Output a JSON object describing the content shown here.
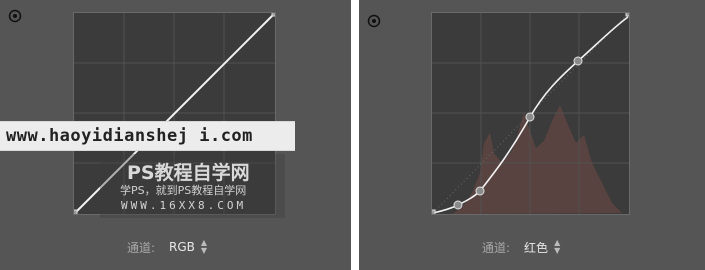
{
  "left_panel": {
    "channel_label": "通道:",
    "channel_value": "RGB"
  },
  "right_panel": {
    "channel_label": "通道:",
    "channel_value": "红色"
  },
  "watermark": {
    "url": "www.haoyidianshej i.com",
    "title": "PS教程自学网",
    "subtitle": "学PS，就到PS教程自学网",
    "site": "WWW.16XX8.COM"
  },
  "colors": {
    "panel_bg": "#555555",
    "curve_bg": "#3b3b3b",
    "curve_line": "#f2f2f2",
    "histogram_red": "#6e4a44"
  },
  "icons": {
    "target_adjust": "target-adjust-icon",
    "updown": "updown-arrows-icon"
  }
}
